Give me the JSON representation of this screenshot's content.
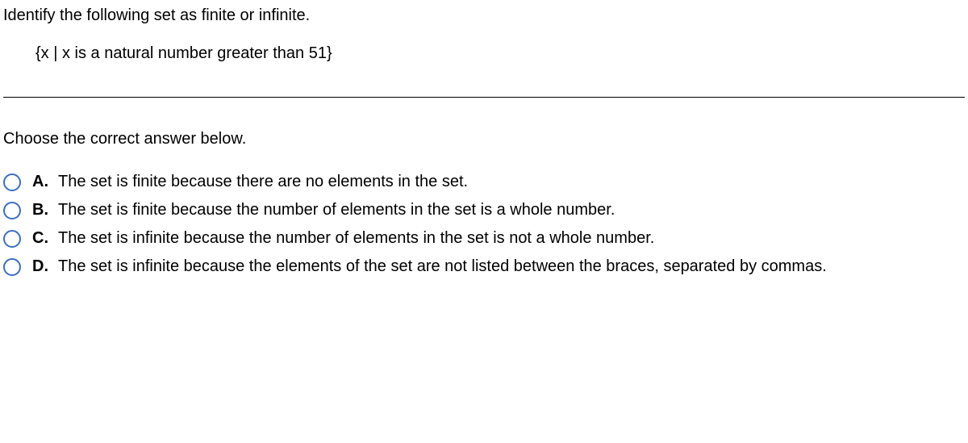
{
  "question": {
    "prompt": "Identify the following set as finite or infinite.",
    "set_notation": "{x | x is a natural number greater than 51}"
  },
  "instruction": "Choose the correct answer below.",
  "options": [
    {
      "letter": "A.",
      "text": "The set is finite because there are no elements in the set."
    },
    {
      "letter": "B.",
      "text": "The set is finite because the number of elements in the set is a whole number."
    },
    {
      "letter": "C.",
      "text": "The set is infinite because the number of elements in the set is not a whole number."
    },
    {
      "letter": "D.",
      "text": "The set is infinite because the elements of the set are not listed between the braces, separated by commas."
    }
  ]
}
